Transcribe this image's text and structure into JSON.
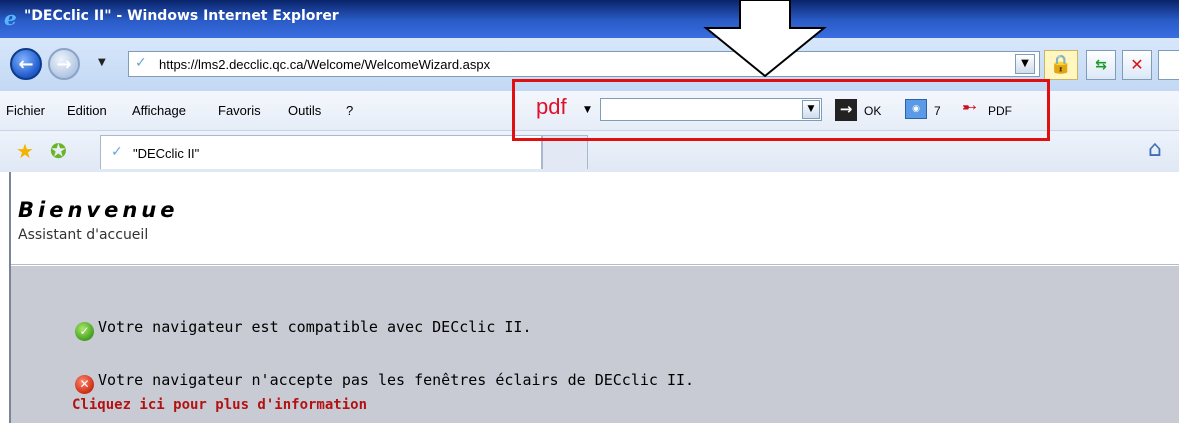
{
  "window": {
    "title": "\"DECclic II\" - Windows Internet Explorer"
  },
  "address_bar": {
    "url": "https://lms2.decclic.qc.ca/Welcome/WelcomeWizard.aspx"
  },
  "menu": {
    "items": [
      "Fichier",
      "Edition",
      "Affichage",
      "Favoris",
      "Outils",
      "?"
    ]
  },
  "pdf_toolbar": {
    "logo": "pdf",
    "ok_label": "OK",
    "count": "7",
    "pdf_label": "PDF"
  },
  "tabs": {
    "active_label": "\"DECclic II\""
  },
  "page": {
    "title": "Bienvenue",
    "subtitle": "Assistant d'accueil",
    "compat_message": "Votre navigateur est compatible avec DECclic II.",
    "popup_message": "Votre navigateur n'accepte pas les fenêtres éclairs de DECclic II.",
    "more_info_link": "Cliquez ici pour plus d'information"
  },
  "colors": {
    "highlight_border": "#e01010",
    "link": "#b21212",
    "pdf_logo": "#e0102a"
  }
}
